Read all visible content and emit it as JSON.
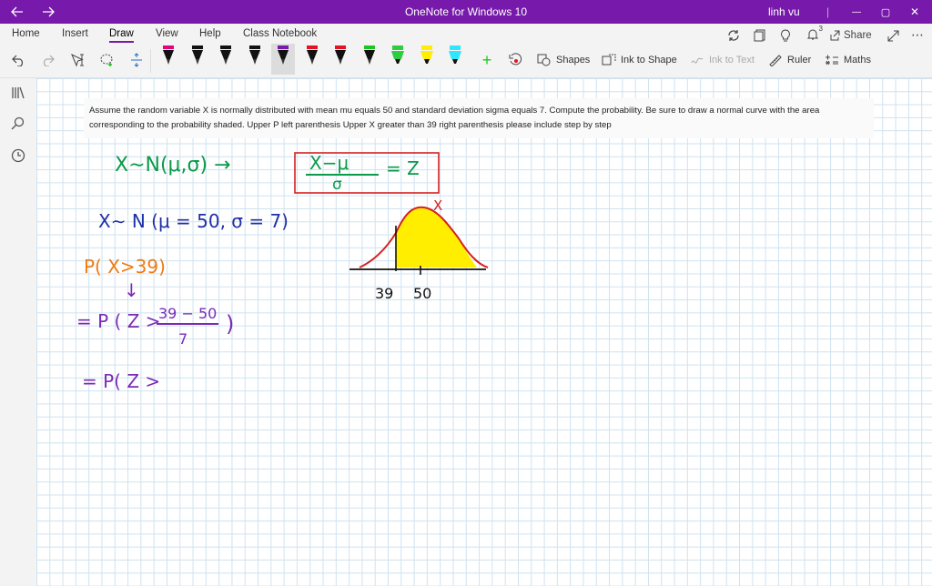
{
  "titlebar": {
    "title": "OneNote for Windows 10",
    "user": "linh vu",
    "minimize_glyph": "—",
    "maximize_glyph": "▢",
    "close_glyph": "✕"
  },
  "menu": {
    "tabs": [
      "Home",
      "Insert",
      "Draw",
      "View",
      "Help",
      "Class Notebook"
    ],
    "active": "Draw",
    "share_label": "Share",
    "notifications_count": "3"
  },
  "draw_tools": {
    "shapes_label": "Shapes",
    "ink_to_shape_label": "Ink to Shape",
    "ink_to_text_label": "Ink to Text",
    "ruler_label": "Ruler",
    "maths_label": "Maths",
    "pens": [
      {
        "name": "pen-1",
        "color": "#e5007e"
      },
      {
        "name": "pen-2",
        "color": "#111111"
      },
      {
        "name": "pen-3",
        "color": "#111111"
      },
      {
        "name": "pen-4",
        "color": "#111111"
      },
      {
        "name": "pen-5",
        "color": "#7719aa"
      },
      {
        "name": "pen-6",
        "color": "#e81123"
      },
      {
        "name": "pen-7",
        "color": "#e81123"
      },
      {
        "name": "pen-8",
        "color": "#1ec51e"
      },
      {
        "name": "highlighter-green",
        "color": "#2ecc40"
      },
      {
        "name": "highlighter-yellow",
        "color": "#ffee00"
      },
      {
        "name": "highlighter-cyan",
        "color": "#2ee6ff"
      }
    ]
  },
  "page": {
    "question": "Assume the random variable X is normally distributed with mean mu equals 50 and standard deviation sigma equals 7. Compute the probability. Be sure to draw a normal curve with the area corresponding to the probability shaded. Upper P left parenthesis Upper X greater than 39 right parenthesis please include step by step"
  },
  "ink": {
    "line1": "X∼N(μ,σ) →",
    "frac_num": "X−μ",
    "frac_den": "σ",
    "eq_z": "= Z",
    "line2": "X∼ N (μ = 50, σ = 7)",
    "line3": "P( X>39)",
    "arrow": "↓",
    "line4_prefix": "= P ( Z >",
    "line4_num": "39 − 50",
    "line4_den": "7",
    "line4_close": ")",
    "line5": "= P( Z >",
    "curve_label_x": "X",
    "axis_tick_39": "39",
    "axis_tick_50": "50",
    "colors": {
      "green": "#0a9a4a",
      "blue": "#1f2fa6",
      "orange": "#f07a12",
      "purple": "#7a2bb5",
      "red": "#d62020",
      "yellow": "#ffee00"
    }
  }
}
